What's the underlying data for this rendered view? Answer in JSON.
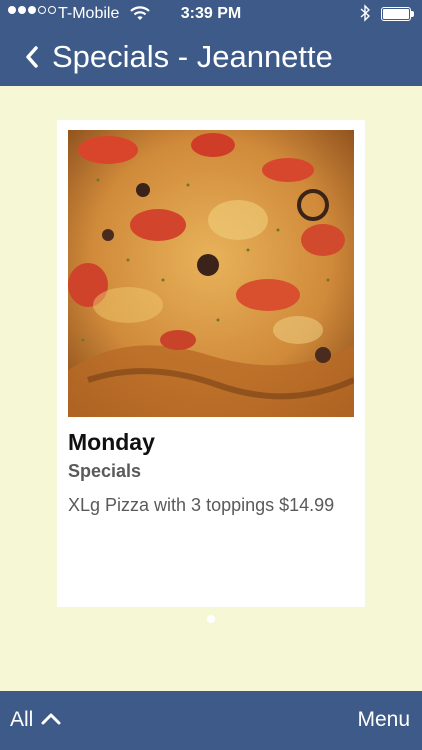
{
  "status_bar": {
    "carrier": "T-Mobile",
    "time": "3:39 PM",
    "signal_bars_filled": 3,
    "signal_bars_total": 5,
    "battery_level": 1.0
  },
  "nav": {
    "title": "Specials - Jeannette",
    "back_icon": "chevron-left-icon"
  },
  "special": {
    "title": "Monday",
    "subtitle": "Specials",
    "description": "XLg Pizza with 3 toppings $14.99",
    "image_icon": "pizza-photo"
  },
  "pager": {
    "current_page": 1,
    "total_pages": 1
  },
  "bottom_bar": {
    "all_label": "All",
    "all_icon": "chevron-up-icon",
    "menu_label": "Menu"
  },
  "colors": {
    "bar": "#3d5a88",
    "content_bg": "#f6f8d5",
    "card_bg": "#ffffff"
  }
}
